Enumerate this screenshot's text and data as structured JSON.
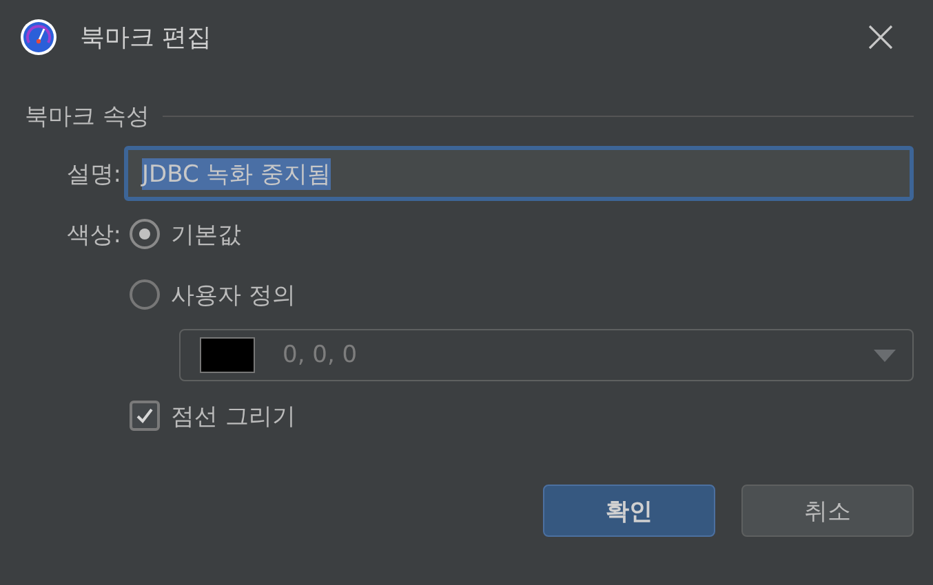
{
  "window": {
    "title": "북마크 편집"
  },
  "section": {
    "title": "북마크 속성"
  },
  "description": {
    "label": "설명:",
    "value": "JDBC 녹화 중지됨",
    "text_selected": true,
    "focused": true
  },
  "color": {
    "label": "색상:",
    "options": [
      {
        "label": "기본값",
        "selected": true
      },
      {
        "label": "사용자 정의",
        "selected": false
      }
    ],
    "dropdown": {
      "value": "0, 0, 0",
      "color": "#000000",
      "disabled": true
    }
  },
  "dashed": {
    "label": "점선 그리기",
    "checked": true
  },
  "buttons": [
    {
      "label": "확인",
      "kind": "primary"
    },
    {
      "label": "취소",
      "kind": "secondary"
    }
  ]
}
